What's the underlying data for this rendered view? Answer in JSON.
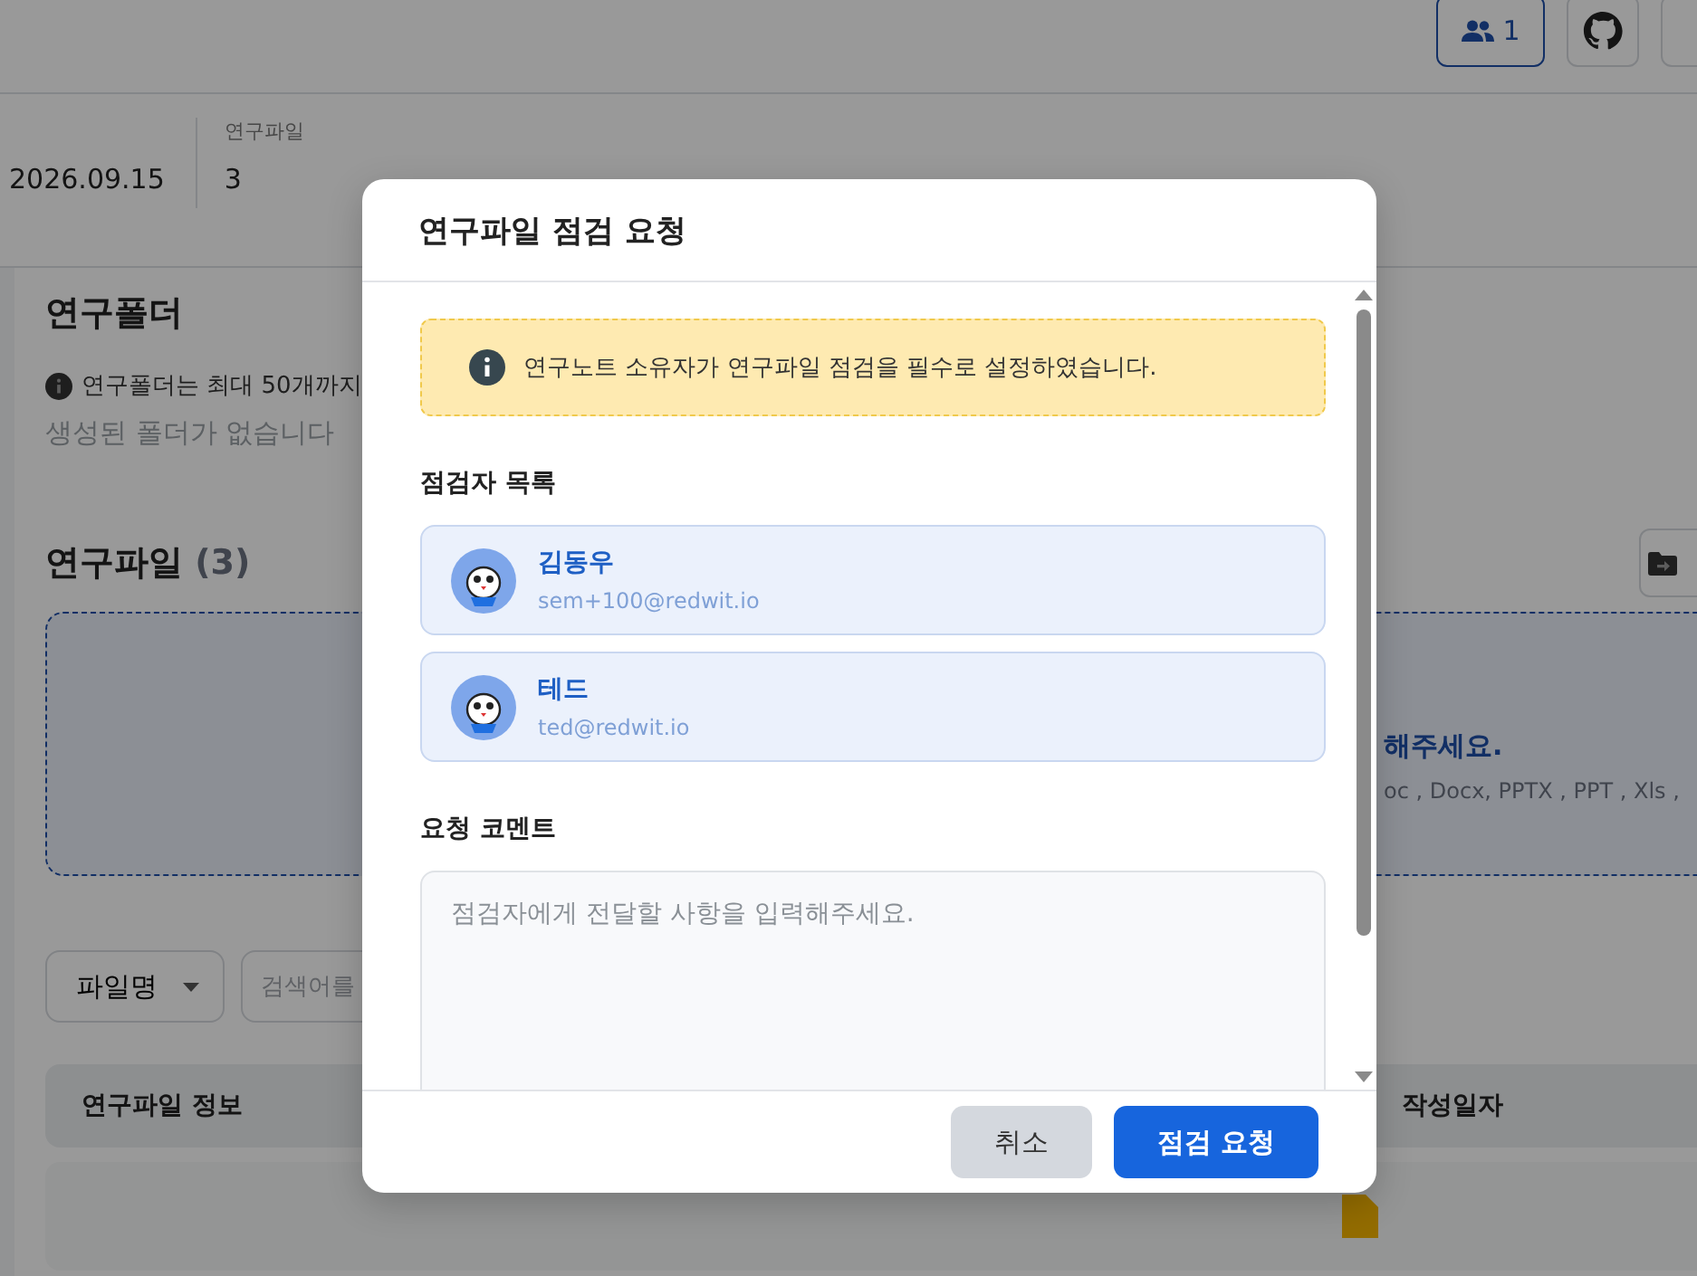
{
  "header": {
    "members_count": "1"
  },
  "summary": {
    "period_end": "2026.09.15",
    "files_label": "연구파일",
    "files_value": "3"
  },
  "folders": {
    "title": "연구폴더",
    "notice": "연구폴더는 최대 50개까지",
    "empty": "생성된 폴더가 없습니다"
  },
  "files": {
    "title": "연구파일",
    "count": "(3)",
    "dropzone_title": "해주세요.",
    "dropzone_formats": "oc , Docx, PPTX , PPT , Xls ,"
  },
  "filter": {
    "field_select": "파일명",
    "search_placeholder": "검색어를"
  },
  "table": {
    "columns": [
      "연구파일 정보",
      "작성일자"
    ]
  },
  "modal": {
    "title": "연구파일 점검 요청",
    "notice": "연구노트 소유자가 연구파일 점검을 필수로 설정하였습니다.",
    "reviewers_label": "점검자 목록",
    "reviewers": [
      {
        "name": "김동우",
        "email": "sem+100@redwit.io"
      },
      {
        "name": "테드",
        "email": "ted@redwit.io"
      }
    ],
    "comment_label": "요청 코멘트",
    "comment_placeholder": "점검자에게 전달할 사항을 입력해주세요.",
    "buttons": [
      {
        "label": "취소",
        "kind": "secondary"
      },
      {
        "label": "점검 요청",
        "kind": "primary"
      }
    ]
  }
}
